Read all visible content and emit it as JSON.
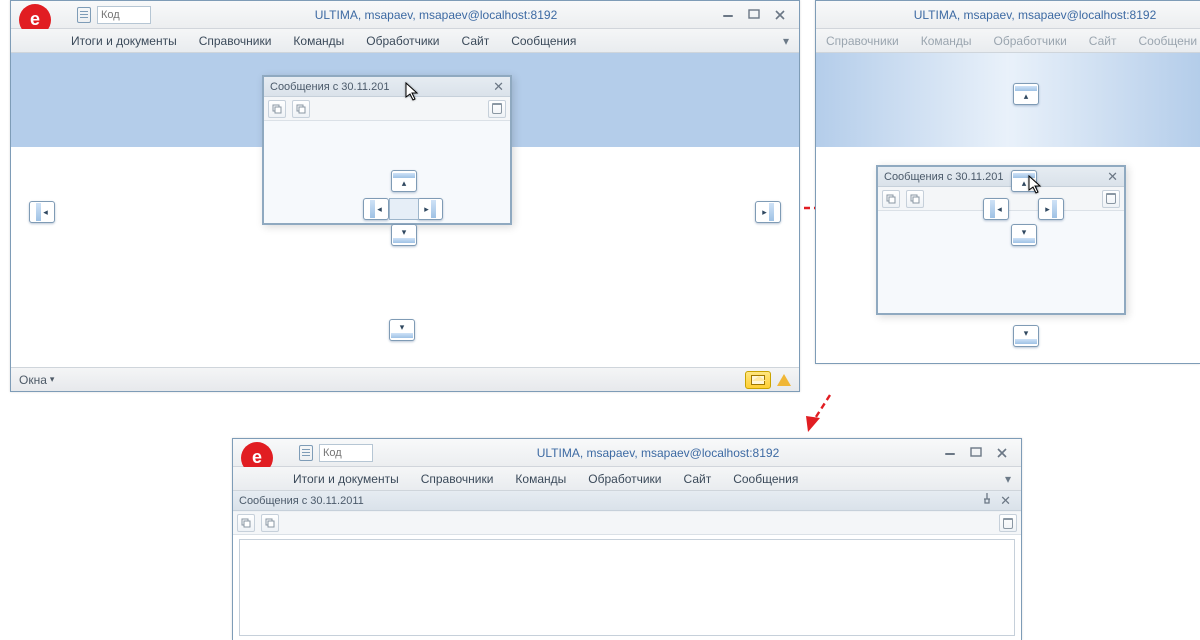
{
  "win1": {
    "code_placeholder": "Код",
    "title": "ULTIMA, msapaev, msapaev@localhost:8192",
    "logo_char": "e",
    "menubar": {
      "m0": "Итоги и документы",
      "m1": "Справочники",
      "m2": "Команды",
      "m3": "Обработчики",
      "m4": "Сайт",
      "m5": "Сообщения"
    },
    "inner_title": "Сообщения с 30.11.201",
    "status_menu": "Окна"
  },
  "win2": {
    "title": "ULTIMA, msapaev, msapaev@localhost:8192",
    "menubar": {
      "m1": "Справочники",
      "m2": "Команды",
      "m3": "Обработчики",
      "m4": "Сайт",
      "m5": "Сообщени"
    },
    "inner_title": "Сообщения с 30.11.201"
  },
  "win3": {
    "code_placeholder": "Код",
    "title": "ULTIMA, msapaev, msapaev@localhost:8192",
    "logo_char": "e",
    "menubar": {
      "m0": "Итоги и документы",
      "m1": "Справочники",
      "m2": "Команды",
      "m3": "Обработчики",
      "m4": "Сайт",
      "m5": "Сообщения"
    },
    "docked_title": "Сообщения с 30.11.2011"
  }
}
